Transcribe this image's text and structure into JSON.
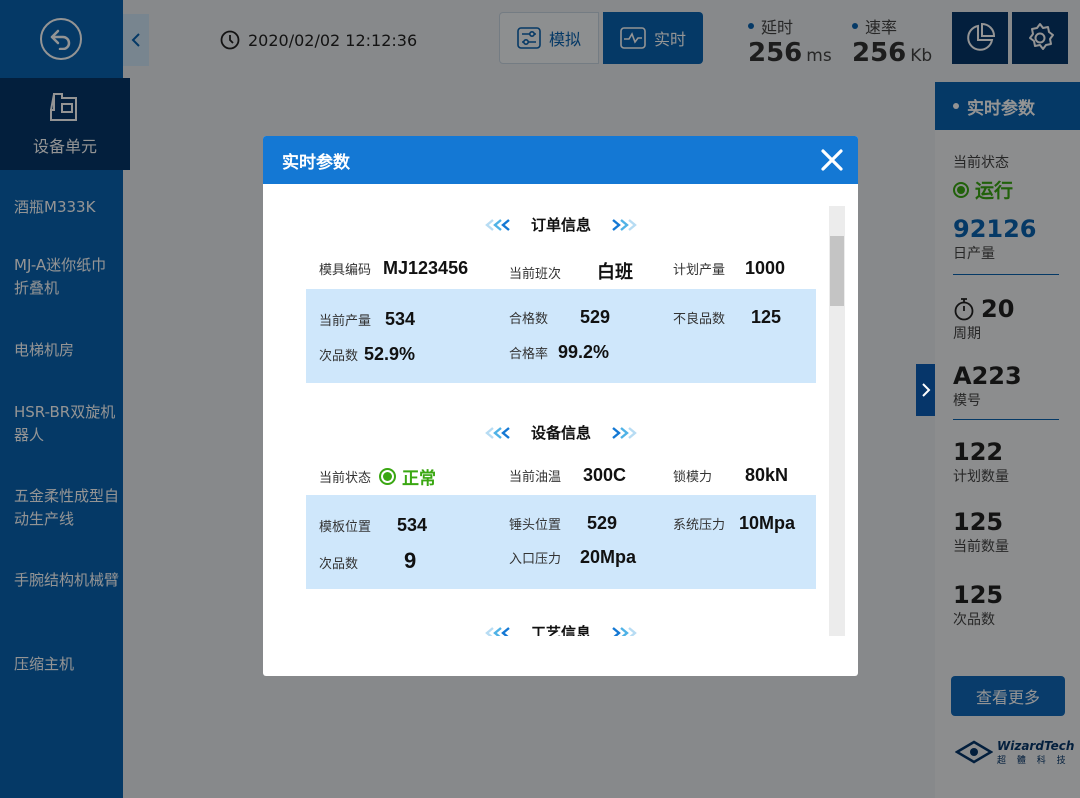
{
  "colors": {
    "primary": "#0a63b0",
    "dark": "#06366a",
    "accent_blue": "#1478d4",
    "light_blue": "#cfe7fb",
    "ok_green": "#3aa712"
  },
  "sidebar": {
    "back_icon": "back-arrow-icon",
    "active_unit": {
      "label": "设备单元",
      "icon": "machine-icon"
    },
    "items": [
      {
        "label": "酒瓶M333K"
      },
      {
        "label": "MJ-A迷你纸巾折叠机"
      },
      {
        "label": "电梯机房"
      },
      {
        "label": "HSR-BR双旋机器人"
      },
      {
        "label": "五金柔性成型自动生产线"
      },
      {
        "label": "手腕结构机械臂"
      },
      {
        "label": "压缩主机"
      }
    ]
  },
  "header": {
    "datetime": "2020/02/02 12:12:36",
    "modes": [
      {
        "label": "模拟",
        "icon": "sliders-icon",
        "active": false
      },
      {
        "label": "实时",
        "icon": "pulse-icon",
        "active": true
      }
    ],
    "latency": {
      "label": "延时",
      "value": "256",
      "unit": "ms"
    },
    "speed": {
      "label": "速率",
      "value": "256",
      "unit": "Kb"
    }
  },
  "right_panel": {
    "title": "实时参数",
    "status_label": "当前状态",
    "status_value": "运行",
    "daily_output": {
      "value": "92126",
      "label": "日产量"
    },
    "cycle": {
      "value": "20",
      "label": "周期"
    },
    "mold_no": {
      "value": "A223",
      "label": "模号"
    },
    "planned_qty": {
      "value": "122",
      "label": "计划数量"
    },
    "current_qty": {
      "value": "125",
      "label": "当前数量"
    },
    "defect_qty": {
      "value": "125",
      "label": "次品数"
    },
    "more_button": "查看更多",
    "brand": {
      "main": "WizardTech",
      "sub": "超 體 科 技"
    }
  },
  "modal": {
    "title": "实时参数",
    "order_section": {
      "title": "订单信息",
      "mold_code_label": "模具编码",
      "mold_code": "MJ123456",
      "shift_label": "当前班次",
      "shift": "白班",
      "plan_label": "计划产量",
      "plan": "1000",
      "current_label": "当前产量",
      "current": "534",
      "qualified_label": "合格数",
      "qualified": "529",
      "bad_label": "不良品数",
      "bad": "125",
      "defect_label": "次品数",
      "defect": "52.9%",
      "rate_label": "合格率",
      "rate": "99.2%"
    },
    "device_section": {
      "title": "设备信息",
      "status_label": "当前状态",
      "status": "正常",
      "oil_label": "当前油温",
      "oil": "300C",
      "clamp_label": "锁模力",
      "clamp": "80kN",
      "plate_label": "模板位置",
      "plate": "534",
      "hammer_label": "锤头位置",
      "hammer": "529",
      "sys_label": "系统压力",
      "sys": "10Mpa",
      "defect_label": "次品数",
      "defect": "9",
      "inlet_label": "入口压力",
      "inlet": "20Mpa"
    },
    "process_section": {
      "title": "工艺信息"
    }
  }
}
